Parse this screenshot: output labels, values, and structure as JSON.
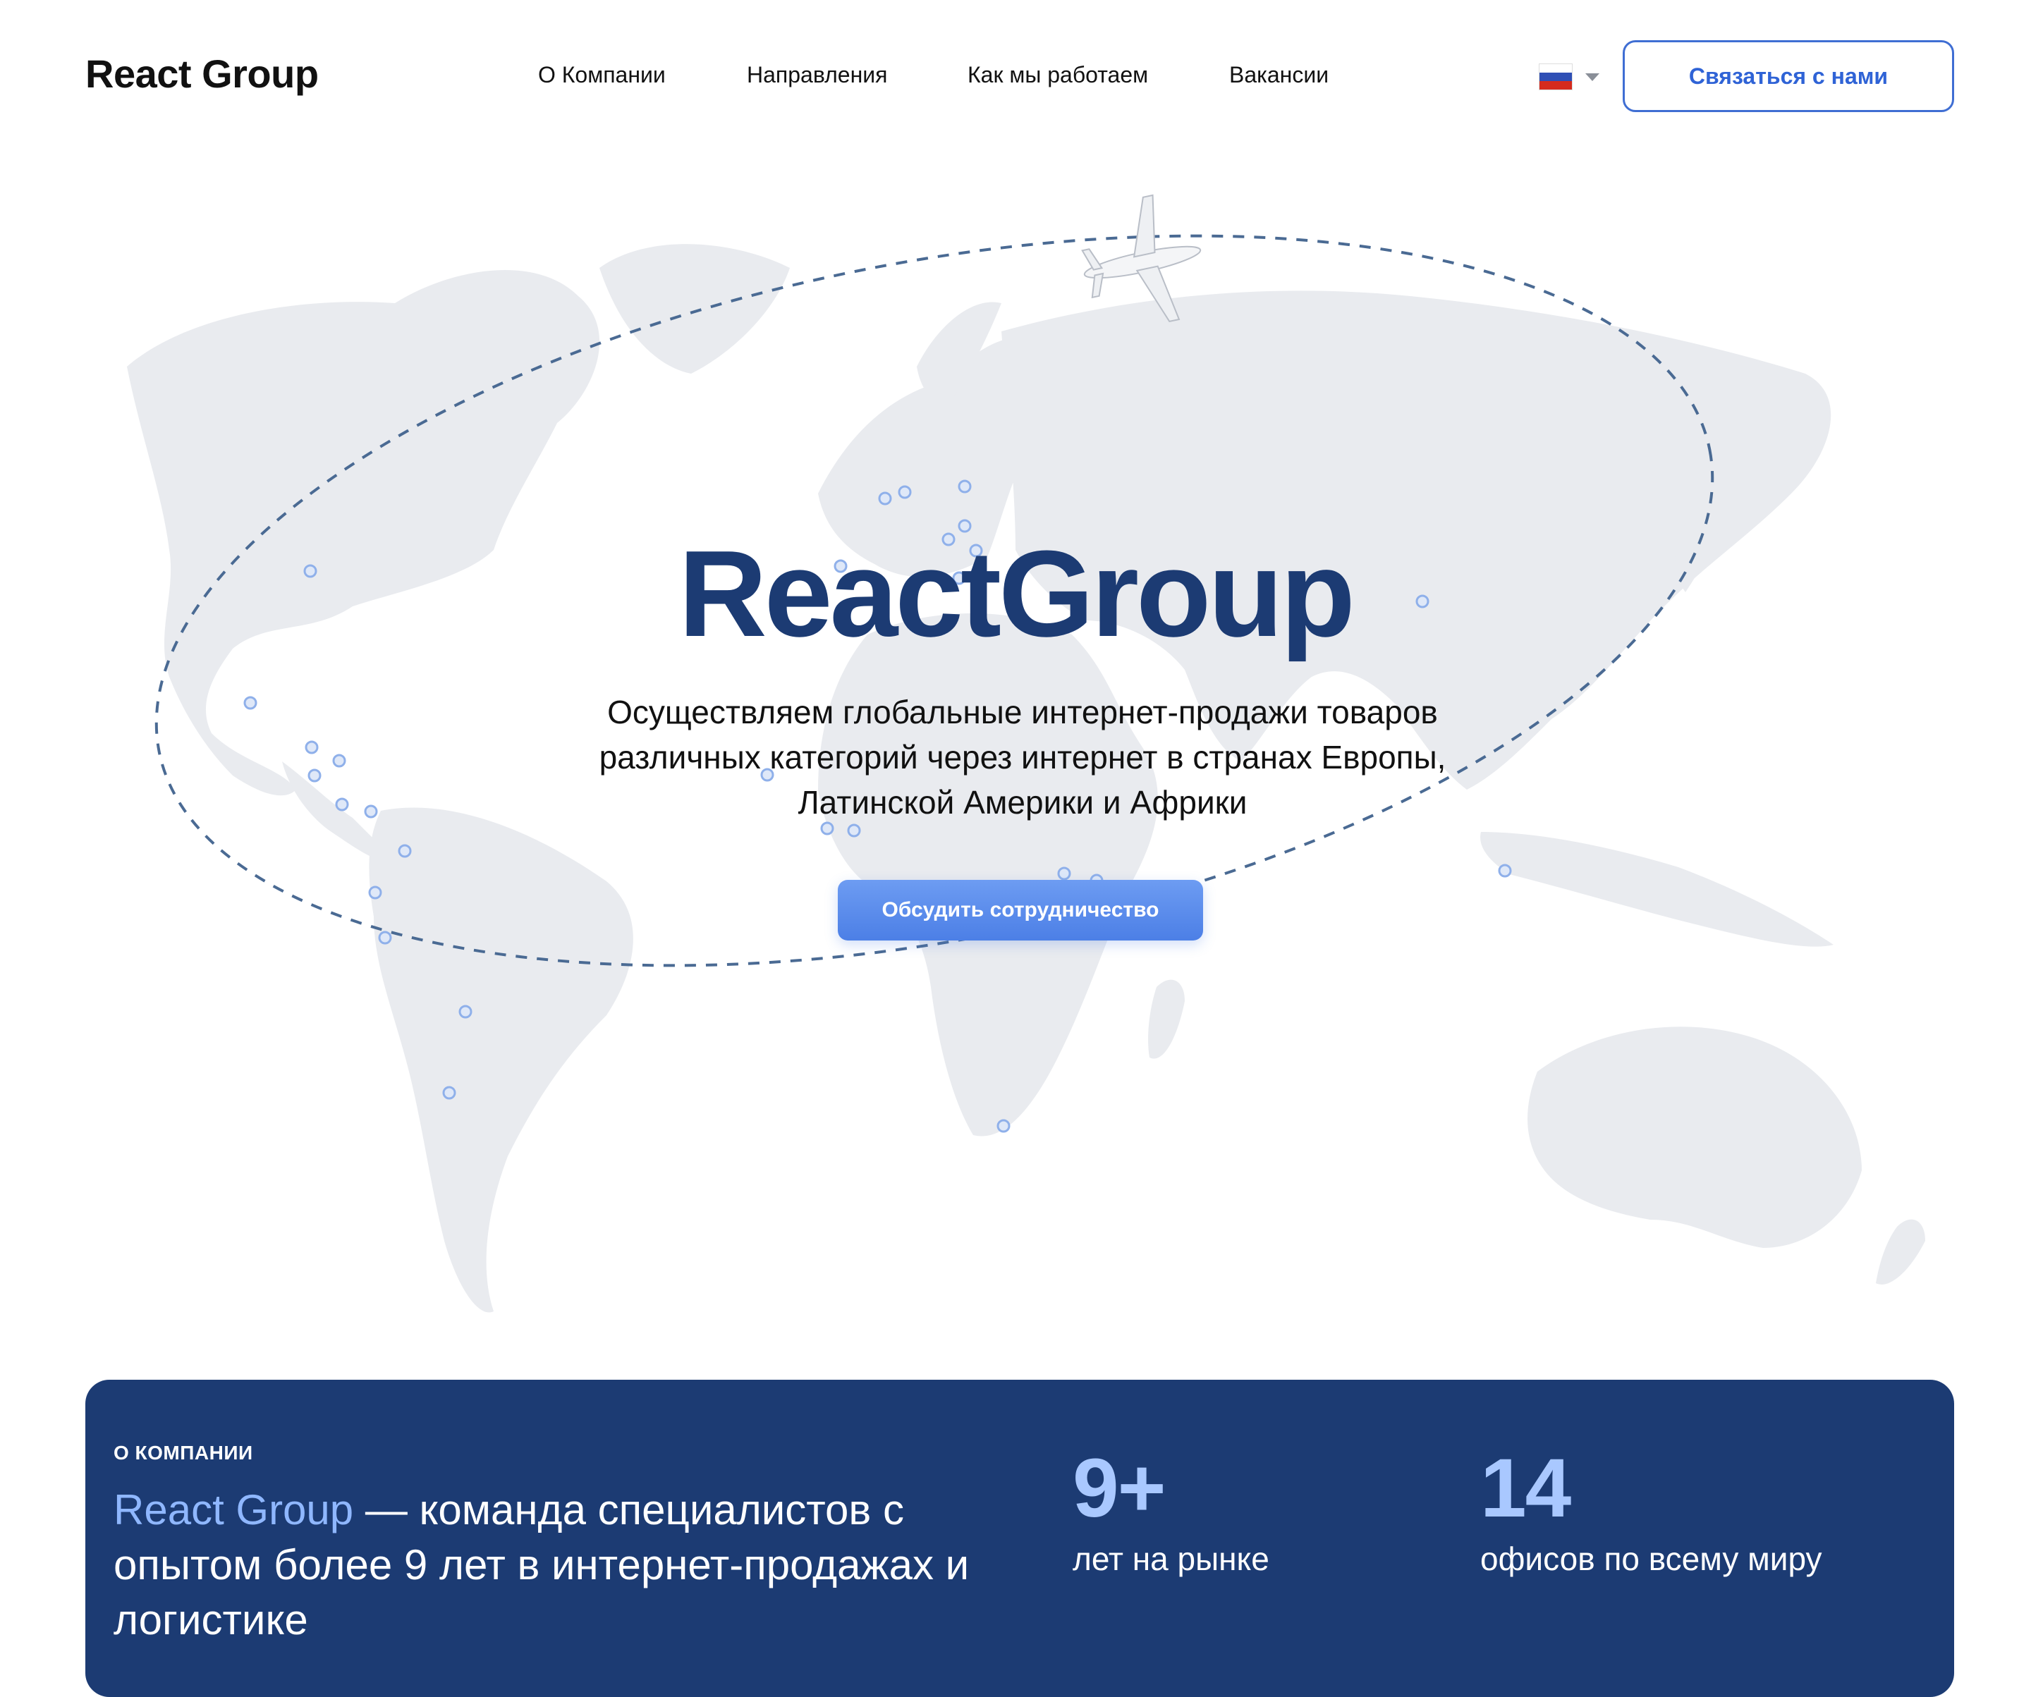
{
  "header": {
    "logo": "React Group",
    "nav": [
      {
        "label": "О Компании"
      },
      {
        "label": "Направления"
      },
      {
        "label": "Как мы работаем"
      },
      {
        "label": "Вакансии"
      }
    ],
    "language": "ru",
    "contact_button": "Связаться с нами"
  },
  "hero": {
    "title": "ReactGroup",
    "subtitle": "Осуществляем глобальные интернет-продажи товаров различных категорий через интернет в странах Европы, Латинской Америки и Африки",
    "cta_button": "Обсудить сотрудничество"
  },
  "about": {
    "eyebrow": "О КОМПАНИИ",
    "text_accent": "React Group",
    "text_rest": " — команда специалистов с опытом более 9 лет в интернет-продажах и логистике",
    "stats": [
      {
        "value": "9+",
        "label": "лет на рынке"
      },
      {
        "value": "14",
        "label": "офисов по всему миру"
      }
    ]
  },
  "colors": {
    "brand": "#1c3b73",
    "accent": "#2f63d6",
    "map": "#e9ebef",
    "marker": "#8fb0ea"
  }
}
